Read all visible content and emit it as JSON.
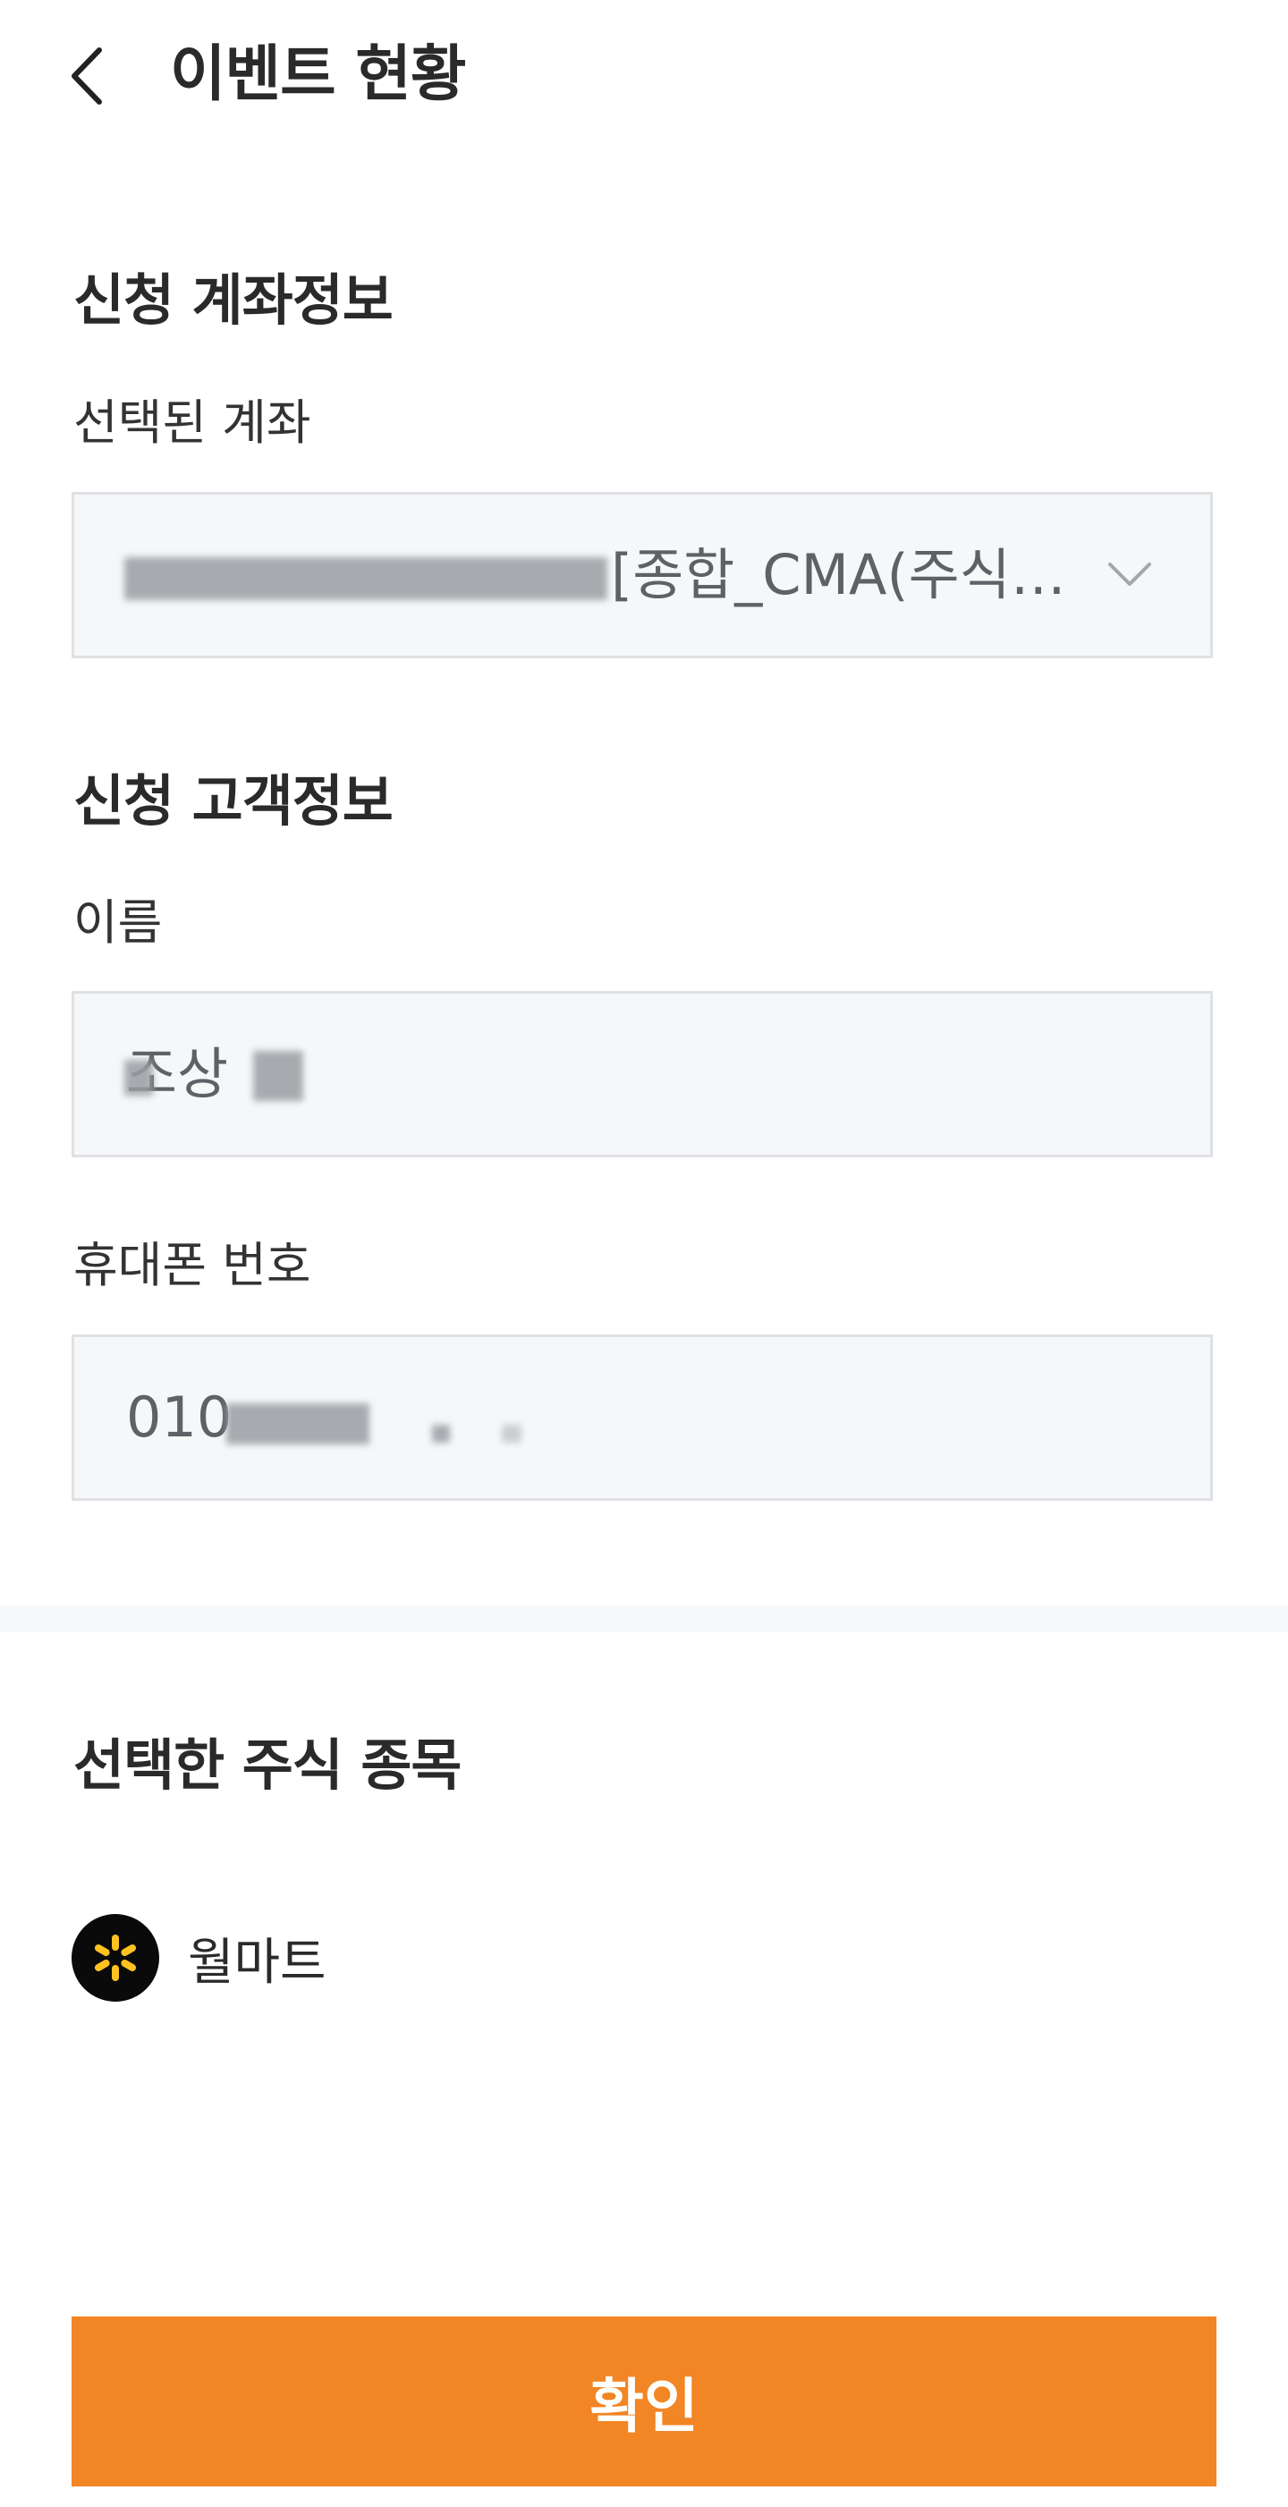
{
  "header": {
    "title": "이벤트 현황"
  },
  "account_section": {
    "title": "신청 계좌정보",
    "selected_account_label": "선택된 계좌",
    "selected_account_value": "[종합_CMA(주식…"
  },
  "customer_section": {
    "title": "신청 고객정보",
    "name_label": "이름",
    "name_value": "조상",
    "phone_label": "휴대폰 번호",
    "phone_value": "010"
  },
  "stock_section": {
    "title": "선택한 주식 종목",
    "stocks": [
      {
        "name": "월마트",
        "icon": "walmart-spark-logo"
      }
    ]
  },
  "confirm_button": {
    "label": "확인"
  },
  "colors": {
    "accent": "#f28524",
    "input_bg": "#f6f7f9",
    "input_border": "#dfe1e4",
    "logo_spark": "#ffc220"
  }
}
